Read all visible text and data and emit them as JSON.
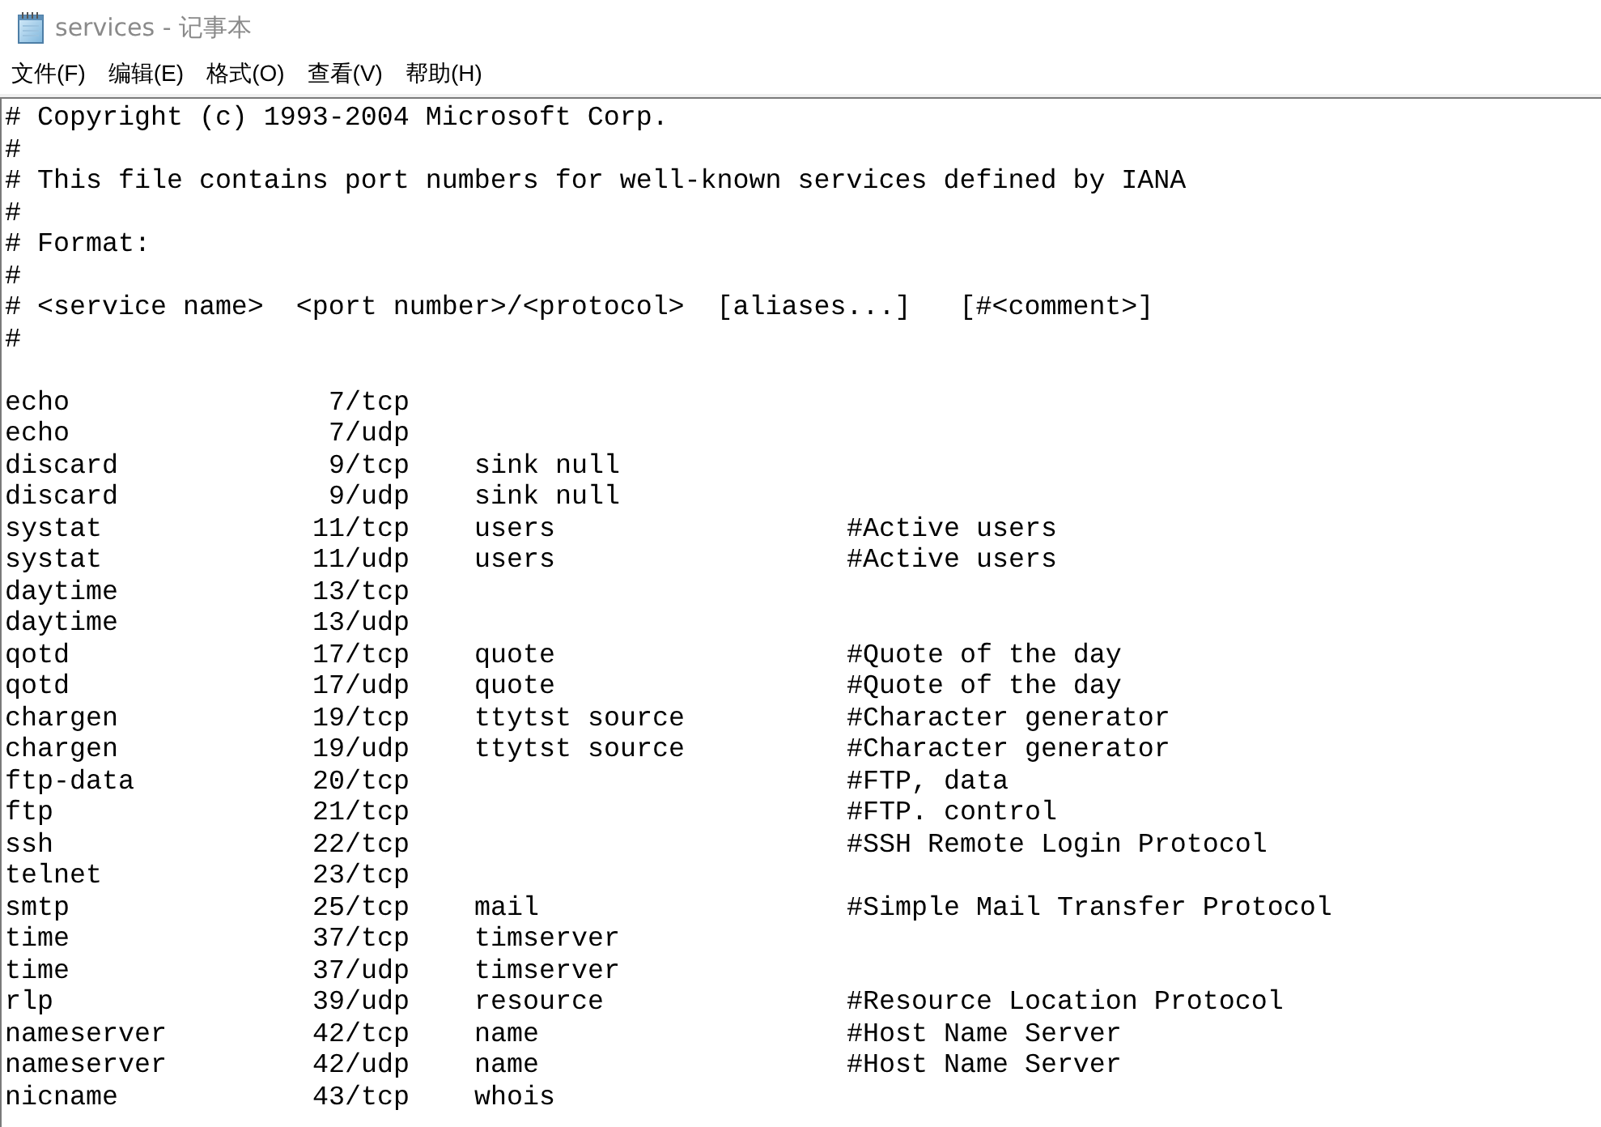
{
  "window": {
    "title": "services - 记事本"
  },
  "menu": [
    "文件(F)",
    "编辑(E)",
    "格式(O)",
    "查看(V)",
    "帮助(H)"
  ],
  "editor": {
    "header_lines": [
      "# Copyright (c) 1993-2004 Microsoft Corp.",
      "#",
      "# This file contains port numbers for well-known services defined by IANA",
      "#",
      "# Format:",
      "#",
      "# <service name>  <port number>/<protocol>  [aliases...]   [#<comment>]",
      "#"
    ],
    "entries": [
      {
        "service": "echo",
        "port": "7/tcp"
      },
      {
        "service": "echo",
        "port": "7/udp"
      },
      {
        "service": "discard",
        "port": "9/tcp",
        "aliases": "sink null"
      },
      {
        "service": "discard",
        "port": "9/udp",
        "aliases": "sink null"
      },
      {
        "service": "systat",
        "port": "11/tcp",
        "aliases": "users",
        "comment": "#Active users"
      },
      {
        "service": "systat",
        "port": "11/udp",
        "aliases": "users",
        "comment": "#Active users"
      },
      {
        "service": "daytime",
        "port": "13/tcp"
      },
      {
        "service": "daytime",
        "port": "13/udp"
      },
      {
        "service": "qotd",
        "port": "17/tcp",
        "aliases": "quote",
        "comment": "#Quote of the day"
      },
      {
        "service": "qotd",
        "port": "17/udp",
        "aliases": "quote",
        "comment": "#Quote of the day"
      },
      {
        "service": "chargen",
        "port": "19/tcp",
        "aliases": "ttytst source",
        "comment": "#Character generator"
      },
      {
        "service": "chargen",
        "port": "19/udp",
        "aliases": "ttytst source",
        "comment": "#Character generator"
      },
      {
        "service": "ftp-data",
        "port": "20/tcp",
        "comment": "#FTP, data"
      },
      {
        "service": "ftp",
        "port": "21/tcp",
        "comment": "#FTP. control"
      },
      {
        "service": "ssh",
        "port": "22/tcp",
        "comment": "#SSH Remote Login Protocol"
      },
      {
        "service": "telnet",
        "port": "23/tcp"
      },
      {
        "service": "smtp",
        "port": "25/tcp",
        "aliases": "mail",
        "comment": "#Simple Mail Transfer Protocol"
      },
      {
        "service": "time",
        "port": "37/tcp",
        "aliases": "timserver"
      },
      {
        "service": "time",
        "port": "37/udp",
        "aliases": "timserver"
      },
      {
        "service": "rlp",
        "port": "39/udp",
        "aliases": "resource",
        "comment": "#Resource Location Protocol"
      },
      {
        "service": "nameserver",
        "port": "42/tcp",
        "aliases": "name",
        "comment": "#Host Name Server"
      },
      {
        "service": "nameserver",
        "port": "42/udp",
        "aliases": "name",
        "comment": "#Host Name Server"
      },
      {
        "service": "nicname",
        "port": "43/tcp",
        "aliases": "whois"
      }
    ]
  }
}
